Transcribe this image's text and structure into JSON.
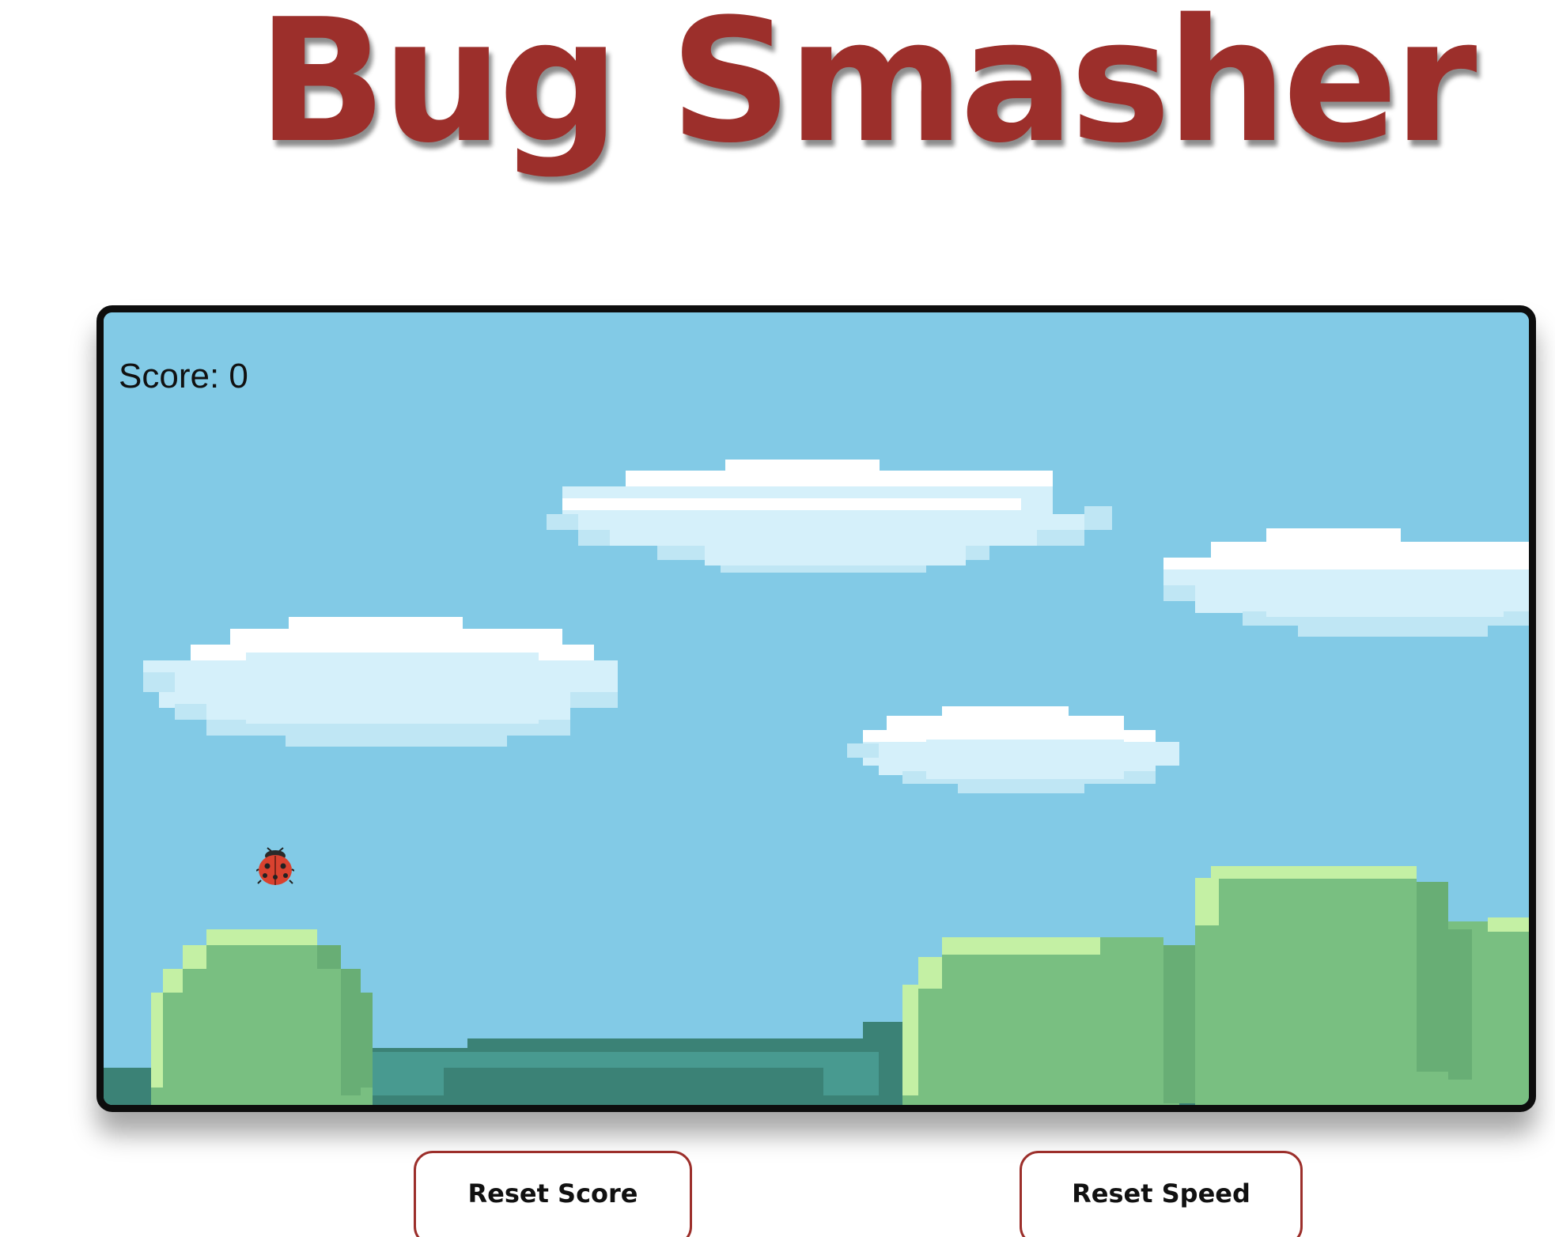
{
  "header": {
    "title": "Bug Smasher"
  },
  "game": {
    "score_label": "Score:",
    "score_value": "0",
    "sprite_icon": "ladybug-icon",
    "colors": {
      "sky": "#82cae6",
      "cloud_white": "#ffffff",
      "cloud_light": "#d5f0fa",
      "cloud_shade": "#bfe6f4",
      "bush_light": "#c4f0a4",
      "bush_mid": "#79bf81",
      "bush_dark": "#68ae75",
      "ground_dark": "#3b8276",
      "ground_teal": "#489a90"
    }
  },
  "controls": {
    "reset_score_label": "Reset Score",
    "reset_speed_label": "Reset Speed"
  },
  "theme": {
    "title_color": "#9c2f2b",
    "button_border": "#9c2f2b"
  }
}
